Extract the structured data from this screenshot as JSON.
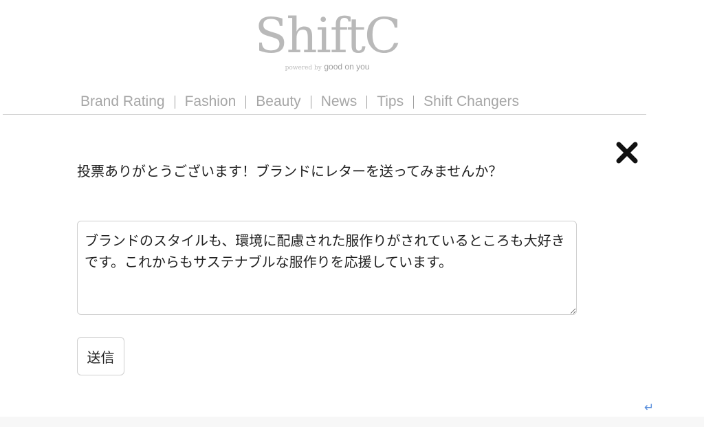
{
  "logo": {
    "word": "ShiftC",
    "powered": "powered by",
    "partner": "good on you"
  },
  "nav": {
    "items": [
      {
        "label": "Brand Rating"
      },
      {
        "label": "Fashion"
      },
      {
        "label": "Beauty"
      },
      {
        "label": "News"
      },
      {
        "label": "Tips"
      },
      {
        "label": "Shift Changers"
      }
    ]
  },
  "dialog": {
    "close_icon": "close-x-icon",
    "prompt": "投票ありがとうございます！ブランドにレターを送ってみませんか？",
    "letter_value": "ブランドのスタイルも、環境に配慮された服作りがされているところも大好きです。これからもサステナブルな服作りを応援しています。",
    "submit_label": "送信"
  },
  "colors": {
    "logo": "#b9b9b9",
    "nav_text": "#a6a6a6",
    "text": "#222222",
    "border": "#cfcfcf",
    "return_icon": "#5a8fdc"
  },
  "icons": {
    "close": "close-x-icon",
    "return": "return-arrow-icon"
  }
}
